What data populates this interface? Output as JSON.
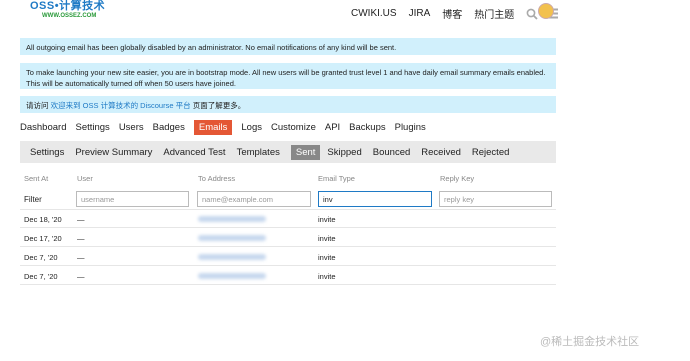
{
  "logo": {
    "main": "OSS•计算技术",
    "sub": "WWW.OSSEZ.COM"
  },
  "nav": {
    "links": [
      "CWIKI.US",
      "JIRA",
      "博客",
      "热门主题"
    ],
    "search_icon": "search-icon",
    "menu_icon": "menu-icon"
  },
  "notices": {
    "email_disabled": "All outgoing email has been globally disabled by an administrator. No email notifications of any kind will be sent.",
    "bootstrap": "To make launching your new site easier, you are in bootstrap mode. All new users will be granted trust level 1 and have daily email summary emails enabled. This will be automatically turned off when 50 users have joined.",
    "welcome_prefix": "请访问",
    "welcome_link": "欢迎来到 OSS 计算技术的 Discourse 平台",
    "welcome_suffix": "页面了解更多。"
  },
  "admin_tabs": [
    "Dashboard",
    "Settings",
    "Users",
    "Badges",
    "Emails",
    "Logs",
    "Customize",
    "API",
    "Backups",
    "Plugins"
  ],
  "admin_tab_active": "Emails",
  "email_tabs": [
    "Settings",
    "Preview Summary",
    "Advanced Test",
    "Templates",
    "Sent",
    "Skipped",
    "Bounced",
    "Received",
    "Rejected"
  ],
  "email_tab_active": "Sent",
  "table": {
    "headers": [
      "Sent At",
      "User",
      "To Address",
      "Email Type",
      "Reply Key"
    ],
    "filter_label": "Filter",
    "placeholders": {
      "user": "username",
      "address": "name@example.com",
      "reply": "reply key"
    },
    "email_type_value": "inv",
    "rows": [
      {
        "date": "Dec 18, '20",
        "user": "—",
        "type": "invite"
      },
      {
        "date": "Dec 17, '20",
        "user": "—",
        "type": "invite"
      },
      {
        "date": "Dec 7, '20",
        "user": "—",
        "type": "invite"
      },
      {
        "date": "Dec 7, '20",
        "user": "—",
        "type": "invite"
      }
    ]
  },
  "watermark": "@稀土掘金技术社区",
  "colors": {
    "accent": "#e45735",
    "notice_bg": "#d1f0fc",
    "link": "#1f7ac5"
  }
}
